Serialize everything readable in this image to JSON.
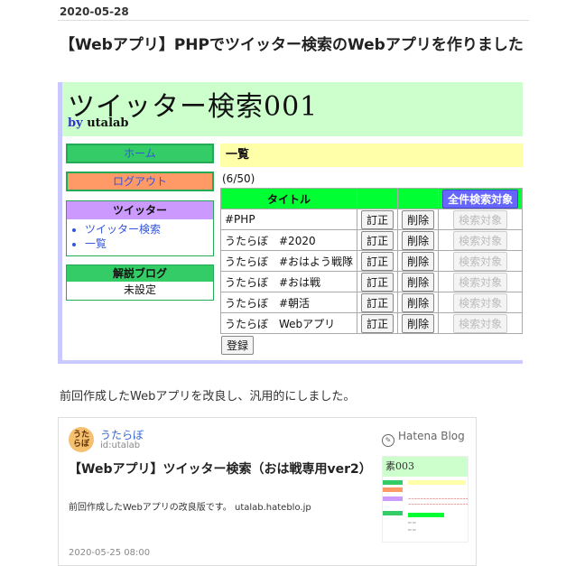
{
  "post": {
    "date": "2020-05-28",
    "title": "【Webアプリ】PHPでツイッター検索のWebアプリを作りました",
    "description": "前回作成したWebアプリを改良し、汎用的にしました。"
  },
  "app": {
    "title": "ツイッター検索001",
    "by_label": "by",
    "author": "utalab",
    "sidebar": {
      "home": "ホーム",
      "logout": "ログアウト",
      "twitter_header": "ツイッター",
      "twitter_links": [
        "ツイッター検索",
        "一覧"
      ],
      "blog_header": "解説ブログ",
      "blog_value": "未設定"
    },
    "list_header": "一覧",
    "count": "(6/50)",
    "table": {
      "col_title": "タイトル",
      "all_search_button": "全件検索対象",
      "edit_label": "訂正",
      "delete_label": "削除",
      "search_target_label": "検索対象",
      "rows": [
        "#PHP",
        "うたらぼ　#2020",
        "うたらぼ　#おはよう戦隊",
        "うたらぼ　#おは戦",
        "うたらぼ　#朝活",
        "うたらぼ　Webアプリ"
      ]
    },
    "register_button": "登録"
  },
  "card": {
    "avatar_text": "うた\nらぼ",
    "author": "うたらぼ",
    "author_id": "id:utalab",
    "brand": "Hatena Blog",
    "title": "【Webアプリ】ツイッター検索（おは戦専用ver2）",
    "description": "前回作成したWebアプリの改良版です。 utalab.hateblo.jp",
    "date": "2020-05-25 08:00",
    "thumb_title": "素003"
  },
  "colors": {
    "header_bg": "#ccffcc",
    "home_bg": "#33cc66",
    "logout_bg": "#ff9966",
    "twitter_header_bg": "#cc99ff",
    "list_header_bg": "#ffffaa",
    "table_header_bg": "#00ff33",
    "all_search_bg": "#6666ff",
    "frame_border": "#c9c9ff"
  }
}
